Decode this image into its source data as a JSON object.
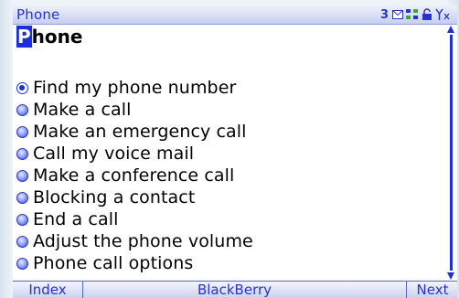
{
  "status_bar": {
    "title": "Phone",
    "message_count": "3",
    "icons": [
      "envelope-icon",
      "network-icon",
      "lock-icon",
      "signal-antenna-icon"
    ]
  },
  "heading": {
    "first_letter": "P",
    "rest": "hone"
  },
  "help_items": [
    {
      "label": "Find my phone number",
      "selected": true
    },
    {
      "label": "Make a call",
      "selected": false
    },
    {
      "label": "Make an emergency call",
      "selected": false
    },
    {
      "label": "Call my voice mail",
      "selected": false
    },
    {
      "label": "Make a conference call",
      "selected": false
    },
    {
      "label": "Blocking a contact",
      "selected": false
    },
    {
      "label": "End a call",
      "selected": false
    },
    {
      "label": "Adjust the phone volume",
      "selected": false
    },
    {
      "label": "Phone call options",
      "selected": false
    }
  ],
  "softkeys": {
    "left": "Index",
    "center": "BlackBerry",
    "right": "Next"
  },
  "colors": {
    "accent": "#1c2fd6",
    "status_text": "#2a33c9"
  }
}
